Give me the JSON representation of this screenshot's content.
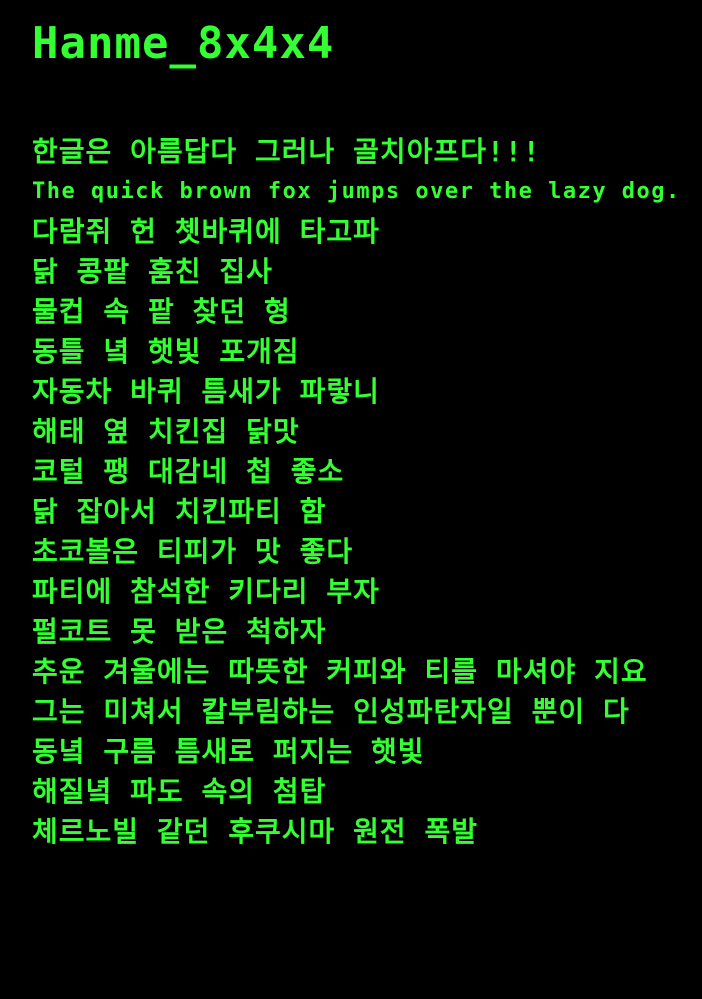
{
  "title": "Hanme_8x4x4",
  "colors": {
    "background": "#000000",
    "text": "#33ff33"
  },
  "lines": [
    "한글은 아름답다 그러나 골치아프다!!!",
    "The quick brown fox jumps over the lazy dog.",
    "다람쥐 헌 쳇바퀴에 타고파",
    "닭 콩팥 훔친 집사",
    "물컵 속 팥 찾던 형",
    "동틀 녘 햇빛 포개짐",
    "자동차 바퀴 틈새가 파랗니",
    "해태 옆 치킨집 닭맛",
    "코털 팽 대감네 첩 좋소",
    "닭 잡아서 치킨파티 함",
    "초코볼은 티피가 맛 좋다",
    "파티에 참석한 키다리 부자",
    "펄코트 못 받은 척하자",
    "추운 겨울에는 따뜻한 커피와 티를 마셔야 지요",
    "그는 미쳐서 칼부림하는 인성파탄자일 뿐이 다",
    "동녘 구름 틈새로 퍼지는 햇빛",
    "해질녘 파도 속의 첨탑",
    "체르노빌 같던 후쿠시마 원전 폭발"
  ]
}
